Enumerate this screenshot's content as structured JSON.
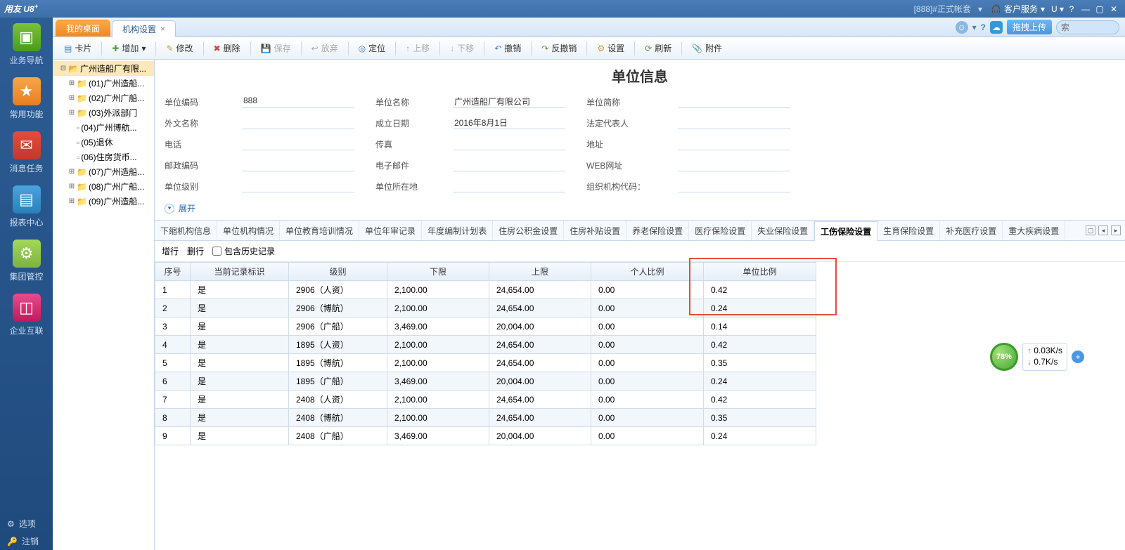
{
  "titlebar": {
    "logo": "用友 U8",
    "logo_sup": "+",
    "account": "[888]#正式帐套",
    "service": "客户服务",
    "u_dropdown": "U",
    "help": "?"
  },
  "leftnav": {
    "items": [
      {
        "label": "业务导航"
      },
      {
        "label": "常用功能"
      },
      {
        "label": "消息任务"
      },
      {
        "label": "报表中心"
      },
      {
        "label": "集团管控"
      },
      {
        "label": "企业互联"
      }
    ],
    "options": "选项",
    "logout": "注销"
  },
  "tabs": {
    "desktop": "我的桌面",
    "org": "机构设置",
    "search_pill": "拖拽上传",
    "search_ext_placeholder": "索"
  },
  "toolbar": {
    "card": "卡片",
    "add": "增加",
    "edit": "修改",
    "delete": "删除",
    "save": "保存",
    "discard": "放弃",
    "locate": "定位",
    "moveup": "上移",
    "movedown": "下移",
    "undo": "撤销",
    "redo": "反撤销",
    "settings": "设置",
    "refresh": "刷新",
    "attachment": "附件"
  },
  "tree": {
    "root": "广州造船厂有限...",
    "nodes": [
      "(01)广州造船...",
      "(02)广州广船...",
      "(03)外派部门",
      "(04)广州博航...",
      "(05)退休",
      "(06)住房货币...",
      "(07)广州造船...",
      "(08)广州广船...",
      "(09)广州造船..."
    ]
  },
  "page": {
    "title": "单位信息",
    "expand": "展开"
  },
  "form": {
    "r1": {
      "l1": "单位编码",
      "v1": "888",
      "l2": "单位名称",
      "v2": "广州造船厂有限公司",
      "l3": "单位简称",
      "v3": ""
    },
    "r2": {
      "l1": "外文名称",
      "v1": "",
      "l2": "成立日期",
      "v2": "2016年8月1日",
      "l3": "法定代表人",
      "v3": ""
    },
    "r3": {
      "l1": "电话",
      "v1": "",
      "l2": "传真",
      "v2": "",
      "l3": "地址",
      "v3": ""
    },
    "r4": {
      "l1": "邮政编码",
      "v1": "",
      "l2": "电子邮件",
      "v2": "",
      "l3": "WEB网址",
      "v3": ""
    },
    "r5": {
      "l1": "单位级别",
      "v1": "",
      "l2": "单位所在地",
      "v2": "",
      "l3": "组织机构代码：",
      "v3": ""
    }
  },
  "innertabs": [
    "下缩机构信息",
    "单位机构情况",
    "单位教育培训情况",
    "单位年审记录",
    "年度编制计划表",
    "住房公积金设置",
    "住房补贴设置",
    "养老保险设置",
    "医疗保险设置",
    "失业保险设置",
    "工伤保险设置",
    "生育保险设置",
    "补充医疗设置",
    "重大疾病设置"
  ],
  "subtoolbar": {
    "addrow": "增行",
    "delrow": "删行",
    "history": "包含历史记录"
  },
  "table": {
    "headers": [
      "序号",
      "当前记录标识",
      "级别",
      "下限",
      "上限",
      "个人比例",
      "单位比例"
    ],
    "rows": [
      [
        "1",
        "是",
        "2906（人资）",
        "2,100.00",
        "24,654.00",
        "0.00",
        "0.42"
      ],
      [
        "2",
        "是",
        "2906（博航）",
        "2,100.00",
        "24,654.00",
        "0.00",
        "0.24"
      ],
      [
        "3",
        "是",
        "2906（广船）",
        "3,469.00",
        "20,004.00",
        "0.00",
        "0.14"
      ],
      [
        "4",
        "是",
        "1895（人资）",
        "2,100.00",
        "24,654.00",
        "0.00",
        "0.42"
      ],
      [
        "5",
        "是",
        "1895（博航）",
        "2,100.00",
        "24,654.00",
        "0.00",
        "0.35"
      ],
      [
        "6",
        "是",
        "1895（广船）",
        "3,469.00",
        "20,004.00",
        "0.00",
        "0.24"
      ],
      [
        "7",
        "是",
        "2408（人资）",
        "2,100.00",
        "24,654.00",
        "0.00",
        "0.42"
      ],
      [
        "8",
        "是",
        "2408（博航）",
        "2,100.00",
        "24,654.00",
        "0.00",
        "0.35"
      ],
      [
        "9",
        "是",
        "2408（广船）",
        "3,469.00",
        "20,004.00",
        "0.00",
        "0.24"
      ]
    ]
  },
  "netwidget": {
    "percent": "78%",
    "up": "0.03K/s",
    "down": "0.7K/s"
  }
}
